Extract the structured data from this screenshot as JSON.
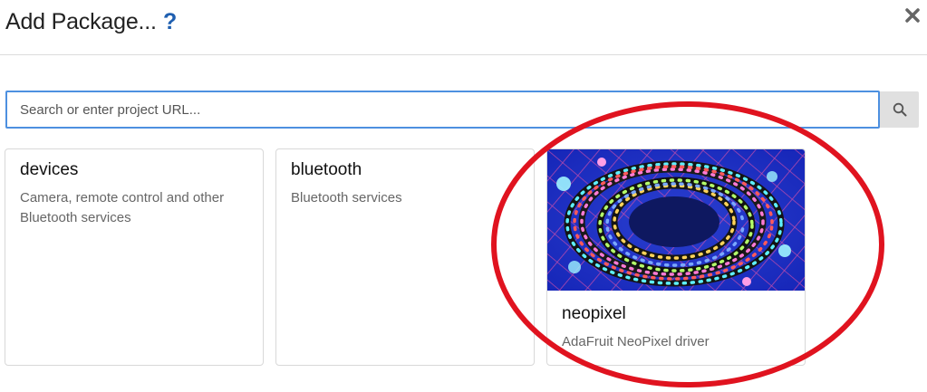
{
  "dialog": {
    "title": "Add Package...",
    "help_label": "?",
    "close_icon": "close-icon"
  },
  "search": {
    "placeholder": "Search or enter project URL...",
    "value": "",
    "button_icon": "search-icon"
  },
  "packages": [
    {
      "title": "devices",
      "description": "Camera, remote control and other Bluetooth services"
    },
    {
      "title": "bluetooth",
      "description": "Bluetooth services"
    },
    {
      "title": "neopixel",
      "description": "AdaFruit NeoPixel driver",
      "image": "neopixel-led-strip-photo"
    }
  ],
  "annotation": {
    "color": "#e0131f",
    "shape": "ellipse"
  }
}
